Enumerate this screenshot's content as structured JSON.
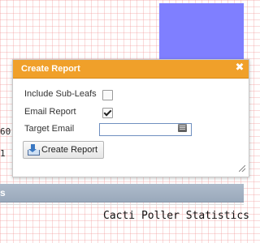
{
  "background": {
    "fragment_1": "60",
    "fragment_2": "1",
    "section_bar_text": "s",
    "graph_title": "Cacti Poller Statistics",
    "graph_fill_color": "#7f7fff"
  },
  "dialog": {
    "title": "Create Report",
    "close_icon": "close-icon",
    "titlebar_color": "#f0a02a",
    "fields": {
      "include_sub_leafs_label": "Include Sub-Leafs",
      "include_sub_leafs_checked": false,
      "email_report_label": "Email Report",
      "email_report_checked": true,
      "target_email_label": "Target Email",
      "target_email_value": "",
      "target_email_placeholder": ""
    },
    "create_button_label": "Create Report",
    "create_button_icon": "download-icon"
  }
}
